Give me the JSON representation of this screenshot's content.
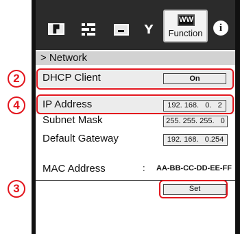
{
  "toolbar": {
    "network_icon_glyph": "▛",
    "function_icon_glyph": "WW",
    "function_label": "Function",
    "info_glyph": "i",
    "tool_glyph": "ʏ"
  },
  "breadcrumb": "> Network",
  "settings": {
    "dhcp": {
      "label": "DHCP Client",
      "value": "On"
    },
    "ip": {
      "label": "IP Address",
      "value": "192. 168.   0.   2"
    },
    "mask": {
      "label": "Subnet Mask",
      "value": "255. 255. 255.   0"
    },
    "gateway": {
      "label": "Default Gateway",
      "value": "192. 168.   0.254"
    },
    "mac": {
      "label": "MAC Address",
      "separator": ":",
      "value": "AA-BB-CC-DD-EE-FF"
    }
  },
  "set_button": "Set",
  "callouts": [
    "2",
    "4",
    "3"
  ],
  "colors": {
    "callout": "#e3151d",
    "toolbar": "#2b2b2b",
    "row_highlight": "#ececec"
  }
}
